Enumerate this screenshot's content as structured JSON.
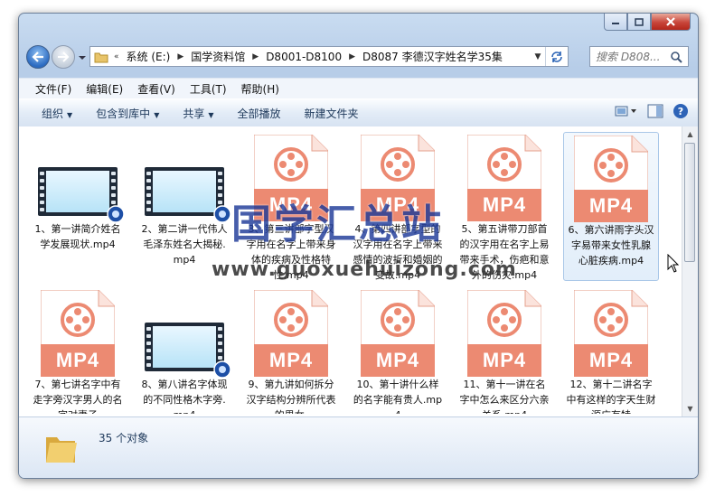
{
  "window": {
    "caption_buttons": [
      "minimize",
      "maximize",
      "close"
    ]
  },
  "address": {
    "root": "«",
    "crumbs": [
      "系统 (E:)",
      "国学资料馆",
      "D8001-D8100",
      "D8087 李德汉字姓名学35集"
    ]
  },
  "search": {
    "placeholder": "搜索 D808..."
  },
  "menu": [
    "文件(F)",
    "编辑(E)",
    "查看(V)",
    "工具(T)",
    "帮助(H)"
  ],
  "toolbar": {
    "organize": "组织",
    "include": "包含到库中",
    "share": "共享",
    "play_all": "全部播放",
    "new_folder": "新建文件夹"
  },
  "files": [
    {
      "name": "1、第一讲简介姓名学发展现状.mp4",
      "icon": "video"
    },
    {
      "name": "2、第二讲一代伟人毛泽东姓名大揭秘.mp4",
      "icon": "video"
    },
    {
      "name": "3、第三讲部字型汉字用在名字上带来身体的疾病及性格特性.mp4",
      "icon": "mp4"
    },
    {
      "name": "4、第四讲部字型的汉字用在名字上带来感情的波折和婚姻的变故.mp4",
      "icon": "mp4"
    },
    {
      "name": "5、第五讲带刀部首的汉字用在名字上易带来手术，伤疤和意外的伤灾.mp4",
      "icon": "mp4"
    },
    {
      "name": "6、第六讲雨字头汉字易带来女性乳腺心脏疾病.mp4",
      "icon": "mp4",
      "selected": true
    },
    {
      "name": "7、第七讲名字中有走字旁汉字男人的名字对妻子",
      "icon": "mp4"
    },
    {
      "name": "8、第八讲名字体现的不同性格木字旁.mp4",
      "icon": "video"
    },
    {
      "name": "9、第九讲如何拆分汉字结构分辨所代表的男女.",
      "icon": "mp4"
    },
    {
      "name": "10、第十讲什么样的名字能有贵人.mp4",
      "icon": "mp4"
    },
    {
      "name": "11、第十一讲在名字中怎么来区分六亲关系.mp4",
      "icon": "mp4"
    },
    {
      "name": "12、第十二讲名字中有这样的字天生财源广有特",
      "icon": "mp4"
    }
  ],
  "file_type_label": "MP4",
  "status": {
    "count": "35 个对象"
  },
  "watermark": {
    "cn": "国学汇总站",
    "url": "www.guoxuehuizong.com"
  },
  "colors": {
    "mp4_band": "#ec8a72",
    "accent": "#1e395b"
  }
}
